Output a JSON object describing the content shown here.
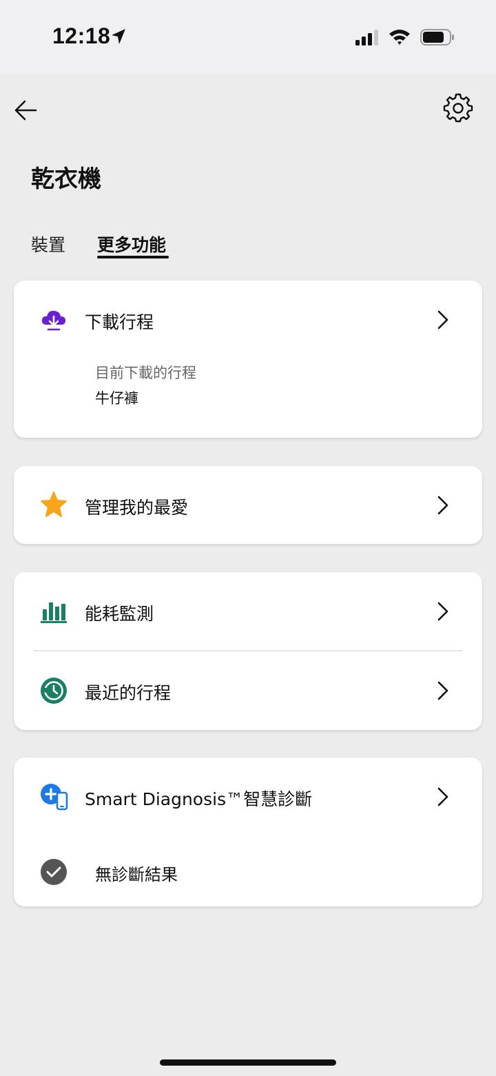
{
  "status": {
    "time": "12:18"
  },
  "header": {
    "title": "乾衣機"
  },
  "tabs": [
    {
      "label": "裝置"
    },
    {
      "label": "更多功能"
    }
  ],
  "download_card": {
    "title": "下載行程",
    "sub_label": "目前下載的行程",
    "sub_value": "牛仔褲"
  },
  "favorites_card": {
    "title": "管理我的最愛"
  },
  "energy_card": {
    "title": "能耗監測"
  },
  "recent_card": {
    "title": "最近的行程"
  },
  "diagnosis_card": {
    "title": "Smart Diagnosis™智慧診斷",
    "result": "無診斷結果"
  },
  "colors": {
    "download_icon": "#6a1fd0",
    "star_icon": "#f7a51b",
    "green_icon": "#1b7f63",
    "diagnosis_icon": "#1e78e6",
    "check_icon": "#555555"
  }
}
